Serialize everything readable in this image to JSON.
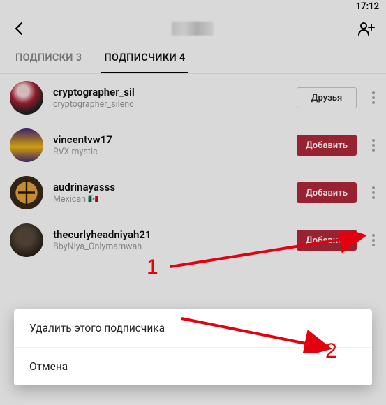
{
  "status": {
    "time": "17:12"
  },
  "tabs": {
    "subscriptions_label": "ПОДПИСКИ",
    "subscriptions_count": "3",
    "followers_label": "ПОДПИСЧИКИ",
    "followers_count": "4"
  },
  "buttons": {
    "friends": "Друзья",
    "add": "Добавить"
  },
  "followers": [
    {
      "username": "cryptographer_sil",
      "bio": "cryptographer_silenc"
    },
    {
      "username": "vincentvw17",
      "bio": "RVX mystic"
    },
    {
      "username": "audrinayasss",
      "bio": "Mexican 🇲🇽"
    },
    {
      "username": "thecurlyheadniyah21",
      "bio": "BbyNiya_Onlymamwah"
    }
  ],
  "sheet": {
    "remove": "Удалить этого подписчика",
    "cancel": "Отмена"
  },
  "annotations": {
    "one": "1",
    "two": "2"
  }
}
